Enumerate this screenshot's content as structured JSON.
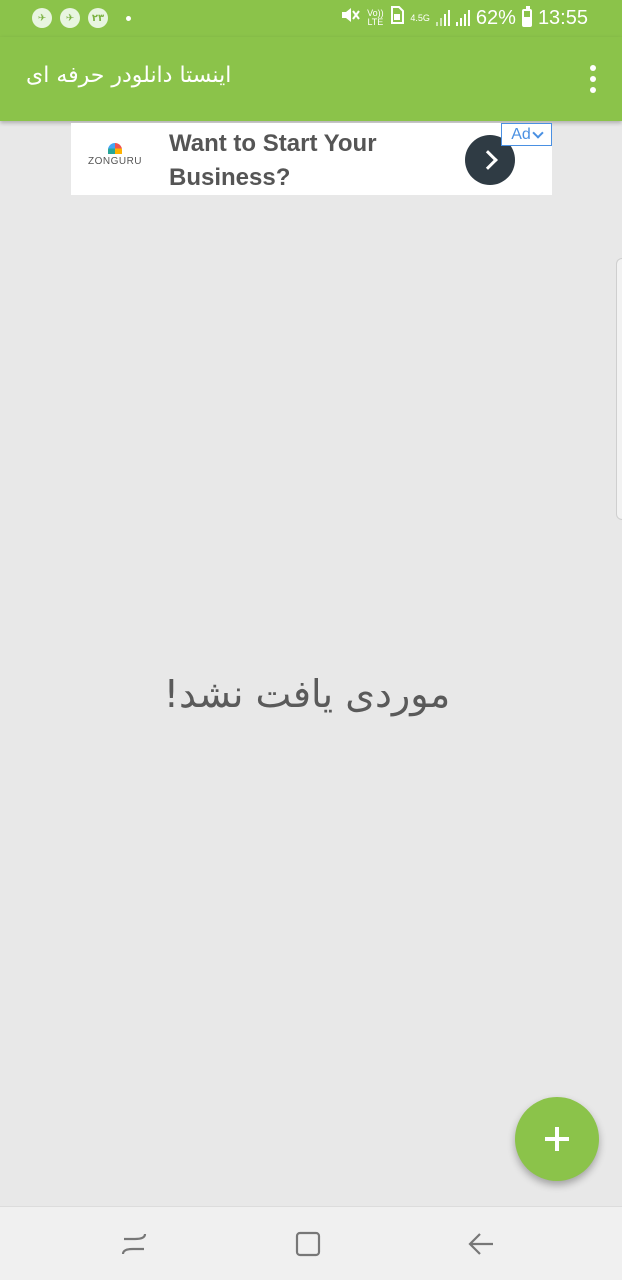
{
  "status_bar": {
    "notifications": [
      {
        "icon": "telegram-icon",
        "label": "✈"
      },
      {
        "icon": "telegram-icon",
        "label": "✈"
      },
      {
        "icon": "badge-icon",
        "label": "۲۳"
      }
    ],
    "volte": "Vo)) LTE",
    "network": "4.5G",
    "battery_percent": "62%",
    "time": "13:55",
    "color": "#8bc34a"
  },
  "app_bar": {
    "title": "اینستا دانلودر حرفه ای",
    "menu_icon": "overflow-menu-icon"
  },
  "ad": {
    "advertiser": "ZONGURU",
    "headline": "Want to Start Your Business?",
    "badge": "Ad",
    "cta_icon": "chevron-right-icon"
  },
  "main": {
    "empty_message": "موردی یافت نشد!"
  },
  "fab": {
    "icon": "plus-icon",
    "color": "#8bc34a"
  },
  "nav_bar": {
    "recent_icon": "recent-apps-icon",
    "home_icon": "home-icon",
    "back_icon": "back-icon"
  }
}
